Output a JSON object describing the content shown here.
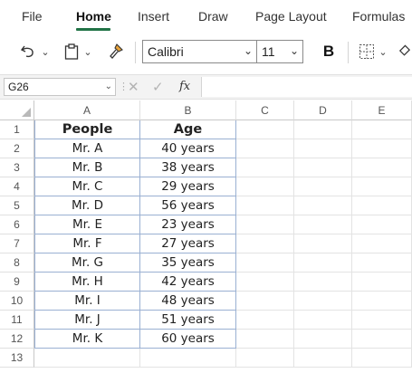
{
  "ribbon": {
    "tabs": [
      {
        "label": "File"
      },
      {
        "label": "Home"
      },
      {
        "label": "Insert"
      },
      {
        "label": "Draw"
      },
      {
        "label": "Page Layout"
      },
      {
        "label": "Formulas"
      }
    ],
    "active_tab": "Home"
  },
  "toolbar": {
    "font_name": "Calibri",
    "font_size": "11",
    "bold_label": "B"
  },
  "formula_bar": {
    "name_box": "G26",
    "fx_label": "fx",
    "formula": ""
  },
  "sheet": {
    "columns": [
      "A",
      "B",
      "C",
      "D",
      "E"
    ],
    "rows": [
      "1",
      "2",
      "3",
      "4",
      "5",
      "6",
      "7",
      "8",
      "9",
      "10",
      "11",
      "12",
      "13"
    ],
    "headers": [
      "People",
      "Age"
    ],
    "data": [
      [
        "Mr. A",
        "40 years"
      ],
      [
        "Mr. B",
        "38 years"
      ],
      [
        "Mr. C",
        "29 years"
      ],
      [
        "Mr. D",
        "56 years"
      ],
      [
        "Mr. E",
        "23 years"
      ],
      [
        "Mr. F",
        "27 years"
      ],
      [
        "Mr. G",
        "35 years"
      ],
      [
        "Mr. H",
        "42 years"
      ],
      [
        "Mr. I",
        "48 years"
      ],
      [
        "Mr. J",
        "51 years"
      ],
      [
        "Mr. K",
        "60 years"
      ]
    ]
  },
  "colors": {
    "accent": "#217346",
    "table_border": "#9ab0d2"
  }
}
